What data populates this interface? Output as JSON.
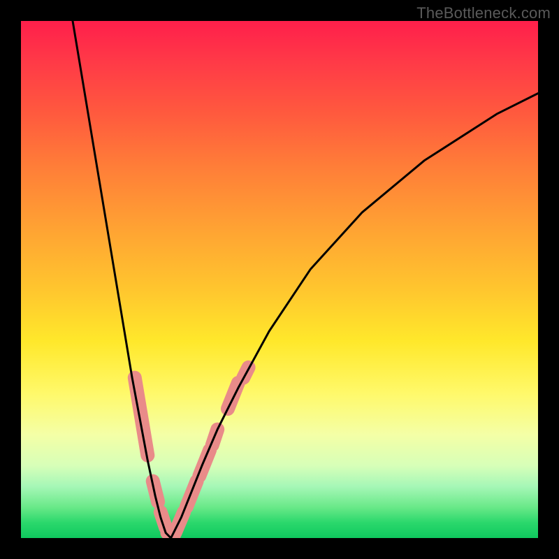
{
  "watermark": "TheBottleneck.com",
  "chart_data": {
    "type": "line",
    "title": "",
    "xlabel": "",
    "ylabel": "",
    "xlim": [
      0,
      100
    ],
    "ylim": [
      0,
      100
    ],
    "series": [
      {
        "name": "curve-left",
        "x": [
          10,
          12,
          14,
          16,
          18,
          20,
          21.5,
          23,
          24.5,
          26,
          27,
          28,
          29
        ],
        "y": [
          100,
          88,
          76,
          64,
          52,
          40,
          31,
          23,
          15,
          8,
          4,
          1,
          0
        ]
      },
      {
        "name": "curve-right",
        "x": [
          29,
          31,
          33,
          35,
          38,
          42,
          48,
          56,
          66,
          78,
          92,
          100
        ],
        "y": [
          0,
          4,
          9,
          14,
          21,
          29,
          40,
          52,
          63,
          73,
          82,
          86
        ]
      }
    ],
    "highlight_bands": [
      {
        "side": "left",
        "x": [
          22.0,
          24.5
        ],
        "y": [
          31,
          16
        ]
      },
      {
        "side": "left",
        "x": [
          25.5,
          26.5
        ],
        "y": [
          11,
          7
        ]
      },
      {
        "side": "left",
        "x": [
          27.0,
          28.0
        ],
        "y": [
          5,
          2
        ]
      },
      {
        "side": "left",
        "x": [
          28.3,
          29.5
        ],
        "y": [
          1,
          0
        ]
      },
      {
        "side": "right",
        "x": [
          29.8,
          31.5
        ],
        "y": [
          1,
          5
        ]
      },
      {
        "side": "right",
        "x": [
          32.0,
          34.0
        ],
        "y": [
          6,
          11
        ]
      },
      {
        "side": "right",
        "x": [
          34.5,
          36.5
        ],
        "y": [
          12,
          17
        ]
      },
      {
        "side": "right",
        "x": [
          37.0,
          38.0
        ],
        "y": [
          18,
          21
        ]
      },
      {
        "side": "right",
        "x": [
          40.0,
          42.0
        ],
        "y": [
          25,
          30
        ]
      },
      {
        "side": "right",
        "x": [
          43.0,
          44.0
        ],
        "y": [
          31,
          33
        ]
      }
    ],
    "colors": {
      "curve": "#000000",
      "highlight": "#e98b89"
    }
  }
}
